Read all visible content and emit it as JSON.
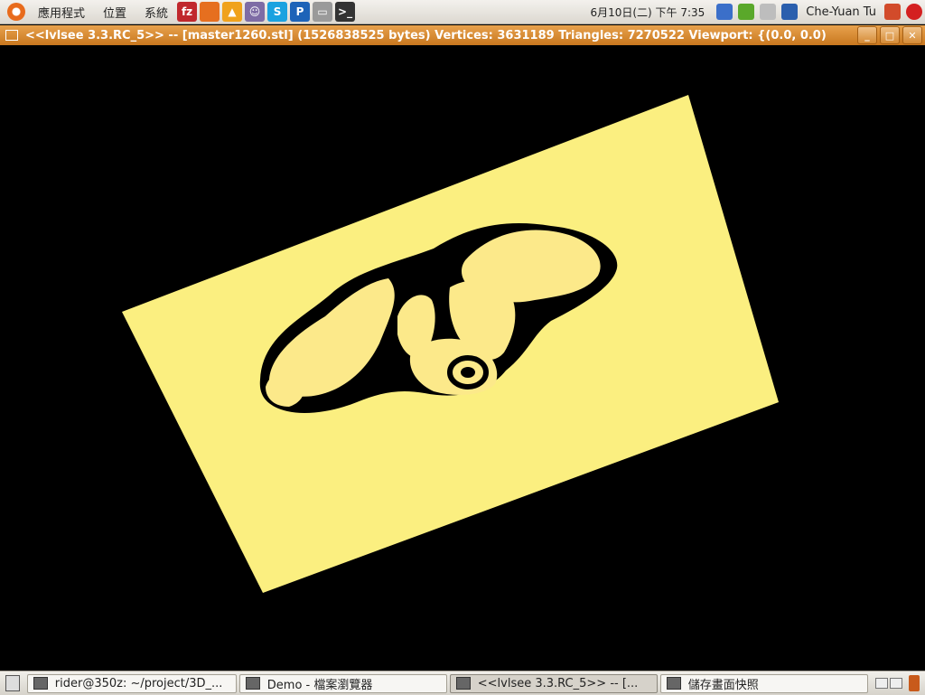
{
  "top_panel": {
    "menus": [
      "應用程式",
      "位置",
      "系統"
    ],
    "launchers": [
      {
        "icon": "filezilla-icon",
        "glyph": "fz",
        "color": "#c0282d"
      },
      {
        "icon": "firefox-icon",
        "glyph": "",
        "color": "#e66f1f"
      },
      {
        "icon": "vlc-icon",
        "glyph": "▲",
        "color": "#f0a21c"
      },
      {
        "icon": "pidgin-icon",
        "glyph": "☺",
        "color": "#7e6ca5"
      },
      {
        "icon": "skype-icon",
        "glyph": "S",
        "color": "#1aa2e0"
      },
      {
        "icon": "p-app-icon",
        "glyph": "P",
        "color": "#1d63b8"
      },
      {
        "icon": "drive-icon",
        "glyph": "▭",
        "color": "#9a9a9a"
      },
      {
        "icon": "terminal-icon",
        "glyph": ">_",
        "color": "#333333"
      }
    ],
    "clock": "6月10日(二) 下午   7:35",
    "user": "Che-Yuan Tu"
  },
  "window": {
    "title": "<<lvlsee 3.3.RC_5>>  --  [master1260.stl] (1526838525 bytes)   Vertices: 3631189   Triangles: 7270522   Viewport: {(0.0, 0.0)"
  },
  "scene": {
    "plane_color": "#fbef80",
    "slice_color": "#fce98a",
    "background": "#000000"
  },
  "taskbar": {
    "tasks": [
      {
        "label": "rider@350z: ~/project/3D_...",
        "icon": "terminal-icon",
        "active": false
      },
      {
        "label": "Demo - 檔案瀏覽器",
        "icon": "file-browser-icon",
        "active": false
      },
      {
        "label": "<<lvlsee 3.3.RC_5>>  -- [...",
        "icon": "window-icon",
        "active": true
      },
      {
        "label": "儲存畫面快照",
        "icon": "camera-icon",
        "active": false
      }
    ]
  }
}
